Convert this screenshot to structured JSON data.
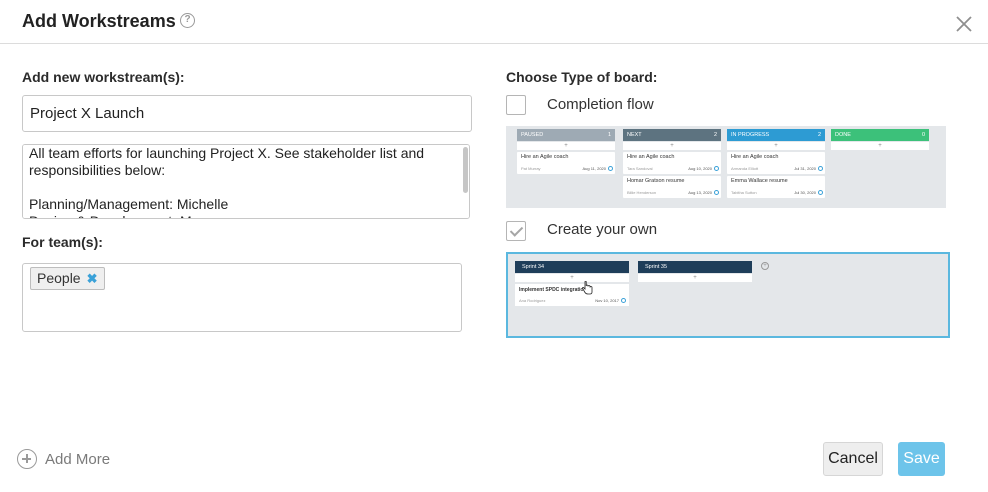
{
  "dialog": {
    "title": "Add Workstreams",
    "help_glyph": "?"
  },
  "form": {
    "workstream_label": "Add new workstream(s):",
    "workstream_name": "Project X Launch",
    "description": "All team efforts for launching Project X. See stakeholder list and responsibilities below:\n\nPlanning/Management: Michelle\nDesign & Development: Manu",
    "teams_label": "For team(s):",
    "teams": [
      {
        "name": "People",
        "remove_glyph": "✖"
      }
    ]
  },
  "board_type": {
    "label": "Choose Type of board:",
    "options": [
      {
        "label": "Completion flow",
        "checked": false,
        "preview": {
          "columns": [
            {
              "title": "PAUSED",
              "count": "1",
              "color": "#9eaab4",
              "cards": [
                {
                  "title": "Hire an Agile coach",
                  "assignee": "Pat Murray",
                  "date": "Aug 11, 2020"
                }
              ]
            },
            {
              "title": "NEXT",
              "count": "2",
              "color": "#5d7380",
              "cards": [
                {
                  "title": "Hire an Agile coach",
                  "assignee": "Tara Sandoval",
                  "date": "Aug 10, 2020"
                },
                {
                  "title": "Homar Gratson resume",
                  "assignee": "Billie Henderson",
                  "date": "Aug 13, 2020"
                }
              ]
            },
            {
              "title": "IN PROGRESS",
              "count": "2",
              "color": "#2d9bd3",
              "cards": [
                {
                  "title": "Hire an Agile coach",
                  "assignee": "Armanda Elliott",
                  "date": "Jul 31, 2020"
                },
                {
                  "title": "Emma Wallace resume",
                  "assignee": "Tabitha Sutton",
                  "date": "Jul 30, 2020"
                }
              ]
            },
            {
              "title": "DONE",
              "count": "0",
              "color": "#3cc17a",
              "cards": []
            }
          ]
        }
      },
      {
        "label": "Create your own",
        "checked": true,
        "preview": {
          "columns": [
            {
              "title": "Sprint 34",
              "cards": [
                {
                  "title": "Implement SPDC integration",
                  "assignee": "Ana Rodriguez",
                  "date": "Nov 10, 2017"
                }
              ]
            },
            {
              "title": "Sprint 35",
              "cards": []
            }
          ]
        }
      }
    ]
  },
  "footer": {
    "add_more": "Add More",
    "cancel": "Cancel",
    "save": "Save"
  }
}
